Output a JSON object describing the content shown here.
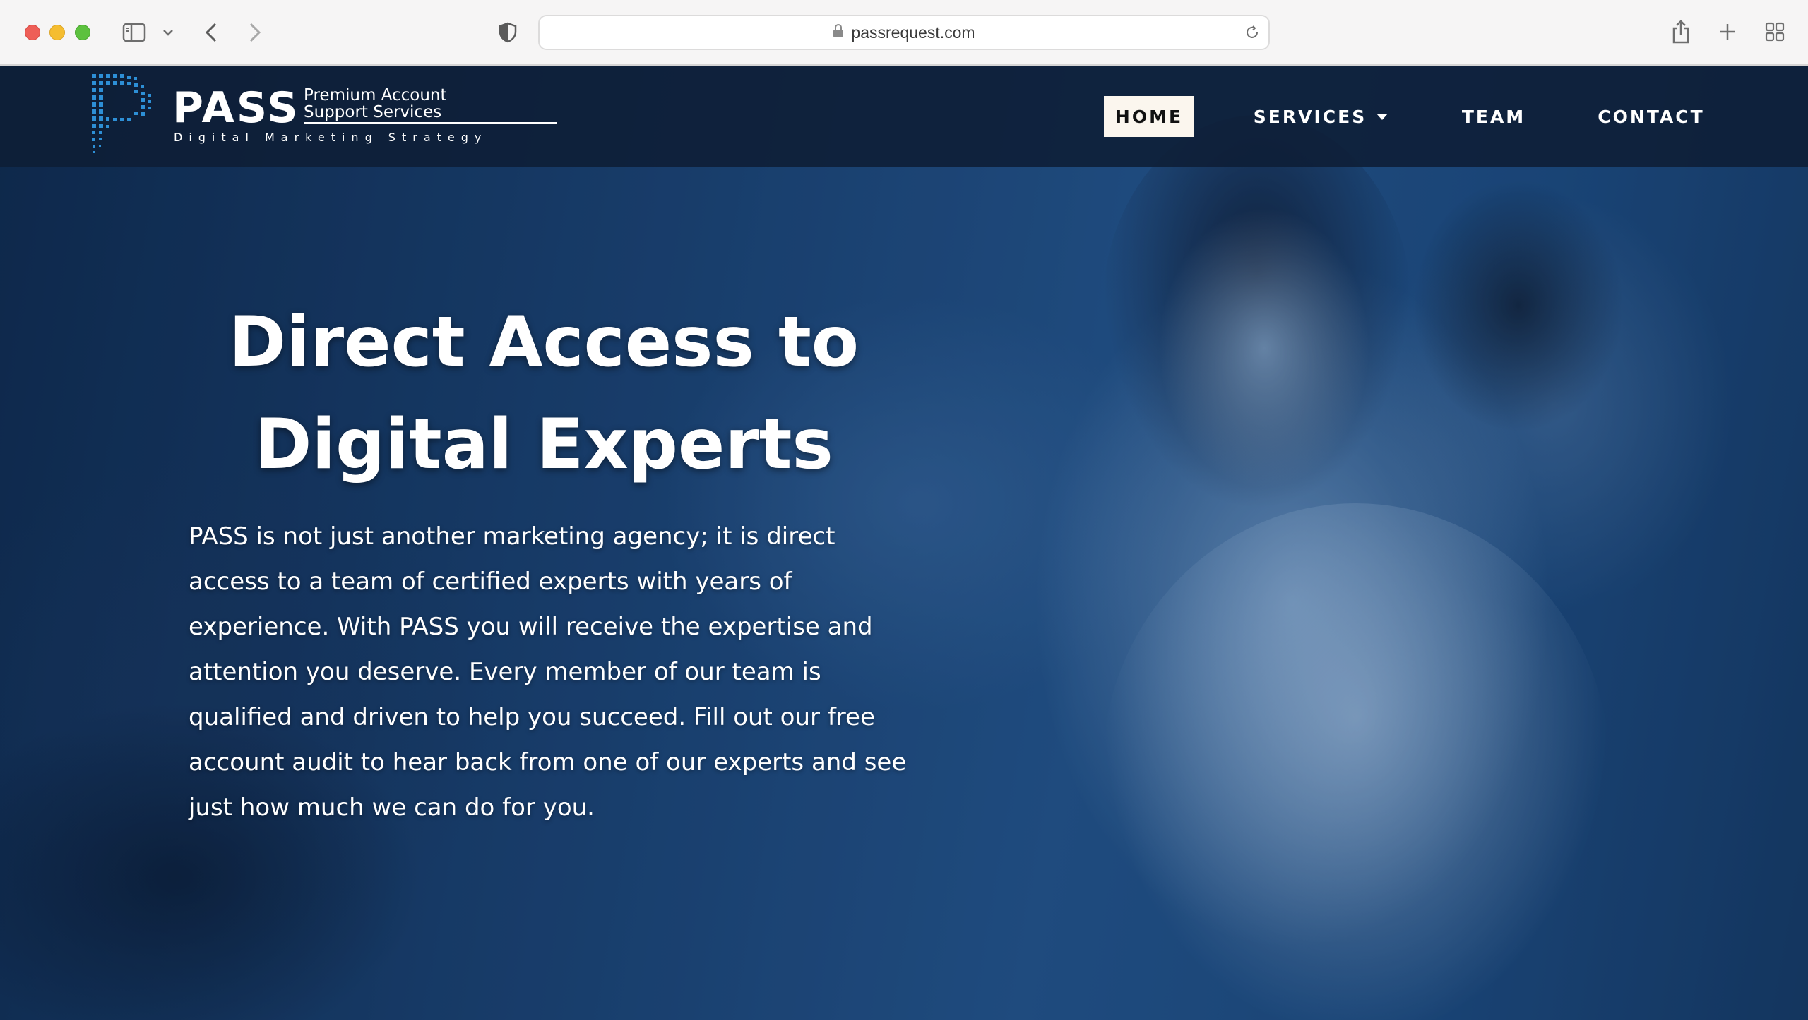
{
  "browser": {
    "url": "passrequest.com"
  },
  "logo": {
    "wordmark": "PASS",
    "line1": "Premium Account",
    "line2": "Support Services",
    "tagline": "Digital Marketing Strategy"
  },
  "nav": {
    "items": [
      {
        "label": "HOME",
        "active": true
      },
      {
        "label": "SERVICES",
        "has_dropdown": true
      },
      {
        "label": "TEAM"
      },
      {
        "label": "CONTACT"
      }
    ]
  },
  "hero": {
    "title_line1": "Direct Access to",
    "title_line2": "Digital Experts",
    "body": "PASS is not just another marketing agency; it is direct access to a team of certified experts with years of experience. With PASS you will receive the expertise and attention you deserve. Every member of our team is qualified and driven to help you succeed. Fill out our free account audit to hear back from one of our experts and see just how much we can do for you."
  },
  "colors": {
    "header_bg": "#0e1e36",
    "hero_tint": "#1f5088",
    "active_nav_bg": "#fbf6ee",
    "logo_accent": "#2d8fd6"
  }
}
